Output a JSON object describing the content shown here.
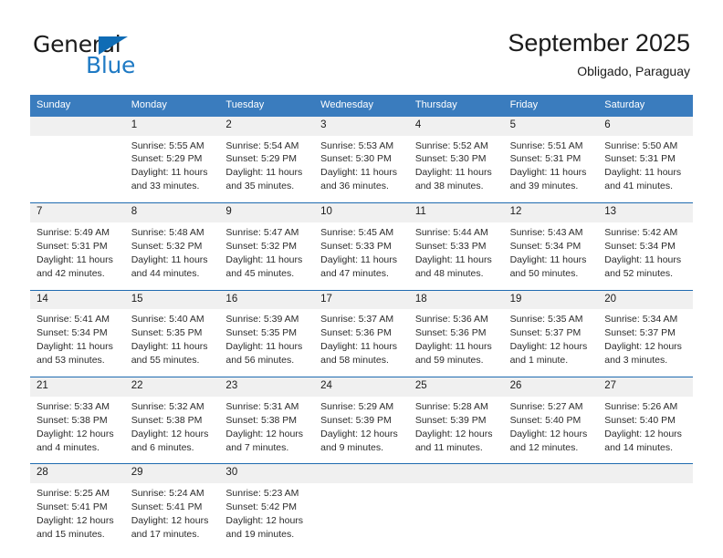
{
  "brand": {
    "line1": "General",
    "line2": "Blue",
    "accent_blue": "#1f7ac4",
    "triangle_blue": "#0f6cb5"
  },
  "header": {
    "title": "September 2025",
    "location": "Obligado, Paraguay"
  },
  "calendar": {
    "header_bg": "#3a7cbe",
    "date_band_bg": "#f0f0f0",
    "separator": "#1f6bb0",
    "weekdays": [
      "Sunday",
      "Monday",
      "Tuesday",
      "Wednesday",
      "Thursday",
      "Friday",
      "Saturday"
    ],
    "weeks": [
      {
        "days": [
          {
            "num": "",
            "lines": []
          },
          {
            "num": "1",
            "lines": [
              "Sunrise: 5:55 AM",
              "Sunset: 5:29 PM",
              "Daylight: 11 hours",
              "and 33 minutes."
            ]
          },
          {
            "num": "2",
            "lines": [
              "Sunrise: 5:54 AM",
              "Sunset: 5:29 PM",
              "Daylight: 11 hours",
              "and 35 minutes."
            ]
          },
          {
            "num": "3",
            "lines": [
              "Sunrise: 5:53 AM",
              "Sunset: 5:30 PM",
              "Daylight: 11 hours",
              "and 36 minutes."
            ]
          },
          {
            "num": "4",
            "lines": [
              "Sunrise: 5:52 AM",
              "Sunset: 5:30 PM",
              "Daylight: 11 hours",
              "and 38 minutes."
            ]
          },
          {
            "num": "5",
            "lines": [
              "Sunrise: 5:51 AM",
              "Sunset: 5:31 PM",
              "Daylight: 11 hours",
              "and 39 minutes."
            ]
          },
          {
            "num": "6",
            "lines": [
              "Sunrise: 5:50 AM",
              "Sunset: 5:31 PM",
              "Daylight: 11 hours",
              "and 41 minutes."
            ]
          }
        ]
      },
      {
        "days": [
          {
            "num": "7",
            "lines": [
              "Sunrise: 5:49 AM",
              "Sunset: 5:31 PM",
              "Daylight: 11 hours",
              "and 42 minutes."
            ]
          },
          {
            "num": "8",
            "lines": [
              "Sunrise: 5:48 AM",
              "Sunset: 5:32 PM",
              "Daylight: 11 hours",
              "and 44 minutes."
            ]
          },
          {
            "num": "9",
            "lines": [
              "Sunrise: 5:47 AM",
              "Sunset: 5:32 PM",
              "Daylight: 11 hours",
              "and 45 minutes."
            ]
          },
          {
            "num": "10",
            "lines": [
              "Sunrise: 5:45 AM",
              "Sunset: 5:33 PM",
              "Daylight: 11 hours",
              "and 47 minutes."
            ]
          },
          {
            "num": "11",
            "lines": [
              "Sunrise: 5:44 AM",
              "Sunset: 5:33 PM",
              "Daylight: 11 hours",
              "and 48 minutes."
            ]
          },
          {
            "num": "12",
            "lines": [
              "Sunrise: 5:43 AM",
              "Sunset: 5:34 PM",
              "Daylight: 11 hours",
              "and 50 minutes."
            ]
          },
          {
            "num": "13",
            "lines": [
              "Sunrise: 5:42 AM",
              "Sunset: 5:34 PM",
              "Daylight: 11 hours",
              "and 52 minutes."
            ]
          }
        ]
      },
      {
        "days": [
          {
            "num": "14",
            "lines": [
              "Sunrise: 5:41 AM",
              "Sunset: 5:34 PM",
              "Daylight: 11 hours",
              "and 53 minutes."
            ]
          },
          {
            "num": "15",
            "lines": [
              "Sunrise: 5:40 AM",
              "Sunset: 5:35 PM",
              "Daylight: 11 hours",
              "and 55 minutes."
            ]
          },
          {
            "num": "16",
            "lines": [
              "Sunrise: 5:39 AM",
              "Sunset: 5:35 PM",
              "Daylight: 11 hours",
              "and 56 minutes."
            ]
          },
          {
            "num": "17",
            "lines": [
              "Sunrise: 5:37 AM",
              "Sunset: 5:36 PM",
              "Daylight: 11 hours",
              "and 58 minutes."
            ]
          },
          {
            "num": "18",
            "lines": [
              "Sunrise: 5:36 AM",
              "Sunset: 5:36 PM",
              "Daylight: 11 hours",
              "and 59 minutes."
            ]
          },
          {
            "num": "19",
            "lines": [
              "Sunrise: 5:35 AM",
              "Sunset: 5:37 PM",
              "Daylight: 12 hours",
              "and 1 minute."
            ]
          },
          {
            "num": "20",
            "lines": [
              "Sunrise: 5:34 AM",
              "Sunset: 5:37 PM",
              "Daylight: 12 hours",
              "and 3 minutes."
            ]
          }
        ]
      },
      {
        "days": [
          {
            "num": "21",
            "lines": [
              "Sunrise: 5:33 AM",
              "Sunset: 5:38 PM",
              "Daylight: 12 hours",
              "and 4 minutes."
            ]
          },
          {
            "num": "22",
            "lines": [
              "Sunrise: 5:32 AM",
              "Sunset: 5:38 PM",
              "Daylight: 12 hours",
              "and 6 minutes."
            ]
          },
          {
            "num": "23",
            "lines": [
              "Sunrise: 5:31 AM",
              "Sunset: 5:38 PM",
              "Daylight: 12 hours",
              "and 7 minutes."
            ]
          },
          {
            "num": "24",
            "lines": [
              "Sunrise: 5:29 AM",
              "Sunset: 5:39 PM",
              "Daylight: 12 hours",
              "and 9 minutes."
            ]
          },
          {
            "num": "25",
            "lines": [
              "Sunrise: 5:28 AM",
              "Sunset: 5:39 PM",
              "Daylight: 12 hours",
              "and 11 minutes."
            ]
          },
          {
            "num": "26",
            "lines": [
              "Sunrise: 5:27 AM",
              "Sunset: 5:40 PM",
              "Daylight: 12 hours",
              "and 12 minutes."
            ]
          },
          {
            "num": "27",
            "lines": [
              "Sunrise: 5:26 AM",
              "Sunset: 5:40 PM",
              "Daylight: 12 hours",
              "and 14 minutes."
            ]
          }
        ]
      },
      {
        "days": [
          {
            "num": "28",
            "lines": [
              "Sunrise: 5:25 AM",
              "Sunset: 5:41 PM",
              "Daylight: 12 hours",
              "and 15 minutes."
            ]
          },
          {
            "num": "29",
            "lines": [
              "Sunrise: 5:24 AM",
              "Sunset: 5:41 PM",
              "Daylight: 12 hours",
              "and 17 minutes."
            ]
          },
          {
            "num": "30",
            "lines": [
              "Sunrise: 5:23 AM",
              "Sunset: 5:42 PM",
              "Daylight: 12 hours",
              "and 19 minutes."
            ]
          },
          {
            "num": "",
            "lines": []
          },
          {
            "num": "",
            "lines": []
          },
          {
            "num": "",
            "lines": []
          },
          {
            "num": "",
            "lines": []
          }
        ]
      }
    ]
  }
}
